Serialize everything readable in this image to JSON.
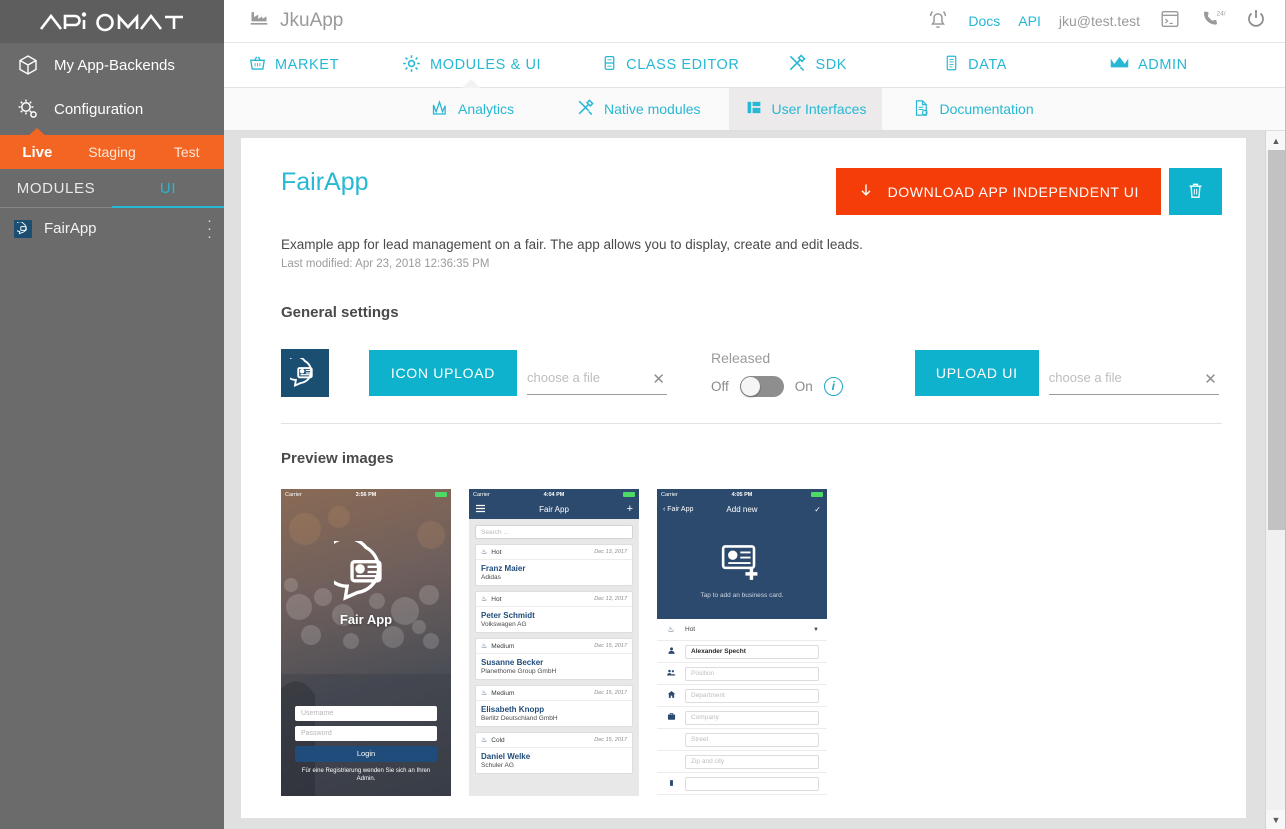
{
  "brand": {
    "logo_text": "APiOMAT",
    "accent_teal": "#26b8d4",
    "accent_orange": "#f26522",
    "download_red": "#f43d09"
  },
  "header": {
    "app_name": "JkuApp",
    "app_icon": "factory-icon",
    "bell_icon": "notification-bell-icon",
    "docs_label": "Docs",
    "api_label": "API",
    "user_email": "jku@test.test",
    "console_icon": "terminal-icon",
    "support_icon": "phone-24-7-icon",
    "power_icon": "power-off-icon"
  },
  "sidebar": {
    "nav": [
      {
        "label": "My App-Backends",
        "icon": "cube-icon"
      },
      {
        "label": "Configuration",
        "icon": "gears-icon"
      }
    ],
    "env_tabs": [
      {
        "label": "Live",
        "active": true
      },
      {
        "label": "Staging",
        "active": false
      },
      {
        "label": "Test",
        "active": false
      }
    ],
    "module_tabs": [
      {
        "label": "MODULES",
        "active": false
      },
      {
        "label": "UI",
        "active": true
      }
    ],
    "modules": [
      {
        "label": "FairApp",
        "icon": "fairapp-icon",
        "menu_icon": "kebab-menu-icon"
      }
    ]
  },
  "mainnav": [
    {
      "label": "MARKET",
      "icon": "basket-icon",
      "active": false
    },
    {
      "label": "MODULES & UI",
      "icon": "gear-icon",
      "active": true
    },
    {
      "label": "CLASS EDITOR",
      "icon": "class-editor-icon",
      "active": false
    },
    {
      "label": "SDK",
      "icon": "tools-icon",
      "active": false
    },
    {
      "label": "DATA",
      "icon": "data-list-icon",
      "active": false
    },
    {
      "label": "ADMIN",
      "icon": "crown-icon",
      "active": false
    }
  ],
  "subnav": [
    {
      "label": "Analytics",
      "icon": "analytics-chart-icon",
      "active": false
    },
    {
      "label": "Native modules",
      "icon": "tools-icon",
      "active": false
    },
    {
      "label": "User Interfaces",
      "icon": "layout-grid-icon",
      "active": true
    },
    {
      "label": "Documentation",
      "icon": "document-icon",
      "active": false
    }
  ],
  "main": {
    "title": "FairApp",
    "download_button": {
      "label": "DOWNLOAD APP INDEPENDENT UI",
      "icon": "download-arrow-icon"
    },
    "delete_button": {
      "icon": "trash-icon"
    },
    "description": "Example app for lead management on a fair. The app allows you to display, create and edit leads.",
    "last_modified": "Last modified: Apr 23, 2018 12:36:35 PM",
    "general_settings_title": "General settings",
    "icon_upload": {
      "button_label": "ICON UPLOAD",
      "placeholder": "choose a file",
      "value": "",
      "clear_icon": "clear-x-icon"
    },
    "released": {
      "label": "Released",
      "off_label": "Off",
      "on_label": "On",
      "state": "off",
      "info_icon": "info-circle-icon"
    },
    "ui_upload": {
      "button_label": "UPLOAD UI",
      "placeholder": "choose a file",
      "value": "",
      "clear_icon": "clear-x-icon"
    },
    "preview_title": "Preview images"
  },
  "previews": [
    {
      "name": "login-screen",
      "status": {
        "carrier": "Carrier",
        "time": "3:56 PM"
      },
      "app_name": "Fair App",
      "username_placeholder": "Username",
      "password_placeholder": "Password",
      "login_label": "Login",
      "note": "Für eine Registrierung wenden Sie sich an Ihren Admin."
    },
    {
      "name": "lead-list-screen",
      "status": {
        "carrier": "Carrier",
        "time": "4:04 PM"
      },
      "nav_title": "Fair App",
      "menu_icon": "hamburger-icon",
      "add_icon": "plus-icon",
      "search_placeholder": "Search ...",
      "leads": [
        {
          "temp": "Hot",
          "date": "Dec 13, 2017",
          "name": "Franz Maier",
          "company": "Adidas"
        },
        {
          "temp": "Hot",
          "date": "Dec 13, 2017",
          "name": "Peter Schmidt",
          "company": "Volkswagen AG"
        },
        {
          "temp": "Medium",
          "date": "Dec 15, 2017",
          "name": "Susanne Becker",
          "company": "Planethome Group GmbH"
        },
        {
          "temp": "Medium",
          "date": "Dec 15, 2017",
          "name": "Elisabeth Knopp",
          "company": "Berlitz Deutschland GmbH"
        },
        {
          "temp": "Cold",
          "date": "Dec 15, 2017",
          "name": "Daniel Welke",
          "company": "Schuler AG"
        }
      ]
    },
    {
      "name": "add-new-screen",
      "status": {
        "carrier": "Carrier",
        "time": "4:05 PM"
      },
      "back_label": "Fair App",
      "nav_title": "Add new",
      "confirm_icon": "checkmark-icon",
      "hero_text": "Tap to add an business card.",
      "hero_icon": "add-business-card-icon",
      "temp_value": "Hot",
      "fields": [
        {
          "icon": "person-icon",
          "value": "Alexander Specht",
          "placeholder": "",
          "filled": true
        },
        {
          "icon": "people-icon",
          "value": "",
          "placeholder": "Position",
          "filled": false
        },
        {
          "icon": "home-icon",
          "value": "",
          "placeholder": "Department",
          "filled": false
        },
        {
          "icon": "briefcase-icon",
          "value": "",
          "placeholder": "Company",
          "filled": false
        },
        {
          "icon": "",
          "value": "",
          "placeholder": "Street",
          "filled": false
        },
        {
          "icon": "",
          "value": "",
          "placeholder": "Zip and city",
          "filled": false
        }
      ]
    }
  ],
  "scrollbar": {
    "up_icon": "scroll-up-arrow",
    "down_icon": "scroll-down-arrow"
  }
}
